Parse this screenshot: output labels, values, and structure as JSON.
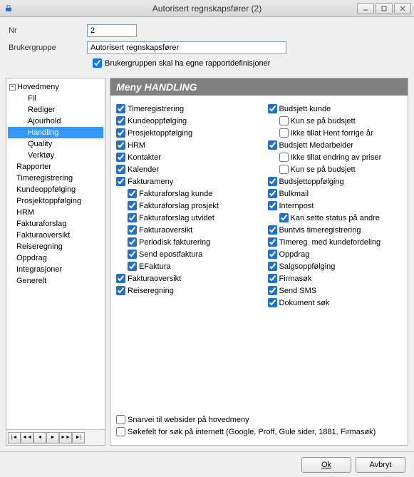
{
  "window": {
    "title": "Autorisert regnskapsfører (2)"
  },
  "form": {
    "nr_label": "Nr",
    "nr_value": "2",
    "gruppe_label": "Brukergruppe",
    "gruppe_value": "Autorisert regnskapsfører",
    "egne_label": "Brukergruppen skal ha egne rapportdefinisjoner"
  },
  "tree": {
    "root": "Hovedmeny",
    "children": [
      "Fil",
      "Rediger",
      "Ajourhold",
      "Handling",
      "Quality",
      "Verktøy"
    ],
    "top": [
      "Rapporter",
      "Timeregistrering",
      "Kundeoppfølging",
      "Prosjektoppfølging",
      "HRM",
      "Fakturaforslag",
      "Fakturaoversikt",
      "Reiseregning",
      "Oppdrag",
      "Integrasjoner",
      "Generelt"
    ]
  },
  "banner": "Meny HANDLING",
  "col1": [
    {
      "label": "Timeregistrering",
      "checked": true,
      "indent": 0
    },
    {
      "label": "Kundeoppfølging",
      "checked": true,
      "indent": 0
    },
    {
      "label": "Prosjektoppfølging",
      "checked": true,
      "indent": 0
    },
    {
      "label": "HRM",
      "checked": true,
      "indent": 0
    },
    {
      "label": "Kontakter",
      "checked": true,
      "indent": 0
    },
    {
      "label": "Kalender",
      "checked": true,
      "indent": 0
    },
    {
      "label": "Fakturameny",
      "checked": true,
      "indent": 0
    },
    {
      "label": "Fakturaforslag kunde",
      "checked": true,
      "indent": 1
    },
    {
      "label": "Fakturaforslag prosjekt",
      "checked": true,
      "indent": 1
    },
    {
      "label": "Fakturaforslag utvidet",
      "checked": true,
      "indent": 1
    },
    {
      "label": "Fakturaoversikt",
      "checked": true,
      "indent": 1
    },
    {
      "label": "Periodisk fakturering",
      "checked": true,
      "indent": 1
    },
    {
      "label": "Send epostfaktura",
      "checked": true,
      "indent": 1
    },
    {
      "label": "EFaktura",
      "checked": true,
      "indent": 1
    },
    {
      "label": "Fakturaoversikt",
      "checked": true,
      "indent": 0
    },
    {
      "label": "Reiseregning",
      "checked": true,
      "indent": 0
    }
  ],
  "col2": [
    {
      "label": "Budsjett kunde",
      "checked": true,
      "indent": 0
    },
    {
      "label": "Kun se på budsjett",
      "checked": false,
      "indent": 1
    },
    {
      "label": "Ikke tillat Hent forrige år",
      "checked": false,
      "indent": 1
    },
    {
      "label": "Budsjett Medarbeider",
      "checked": true,
      "indent": 0
    },
    {
      "label": "Ikke tillat endring av priser",
      "checked": false,
      "indent": 1
    },
    {
      "label": "Kun se på budsjett",
      "checked": false,
      "indent": 1
    },
    {
      "label": "Budsjettoppfølging",
      "checked": true,
      "indent": 0
    },
    {
      "label": "Bulkmail",
      "checked": true,
      "indent": 0
    },
    {
      "label": "Internpost",
      "checked": true,
      "indent": 0
    },
    {
      "label": "Kan sette status på andre",
      "checked": true,
      "indent": 1
    },
    {
      "label": "Buntvis timeregistrering",
      "checked": true,
      "indent": 0
    },
    {
      "label": "Timereg. med kundefordeling",
      "checked": true,
      "indent": 0
    },
    {
      "label": "Oppdrag",
      "checked": true,
      "indent": 0
    },
    {
      "label": "Salgsoppfølging",
      "checked": true,
      "indent": 0
    },
    {
      "label": "Firmasøk",
      "checked": true,
      "indent": 0
    },
    {
      "label": "Send SMS",
      "checked": true,
      "indent": 0
    },
    {
      "label": "Dokument søk",
      "checked": true,
      "indent": 0
    }
  ],
  "bottom": [
    {
      "label": "Snarvei til websider på hovedmeny",
      "checked": false
    },
    {
      "label": "Søkefelt for søk på internett (Google, Proff, Gule sider, 1881, Firmasøk)",
      "checked": false
    }
  ],
  "buttons": {
    "ok": "Ok",
    "avbryt": "Avbryt"
  }
}
